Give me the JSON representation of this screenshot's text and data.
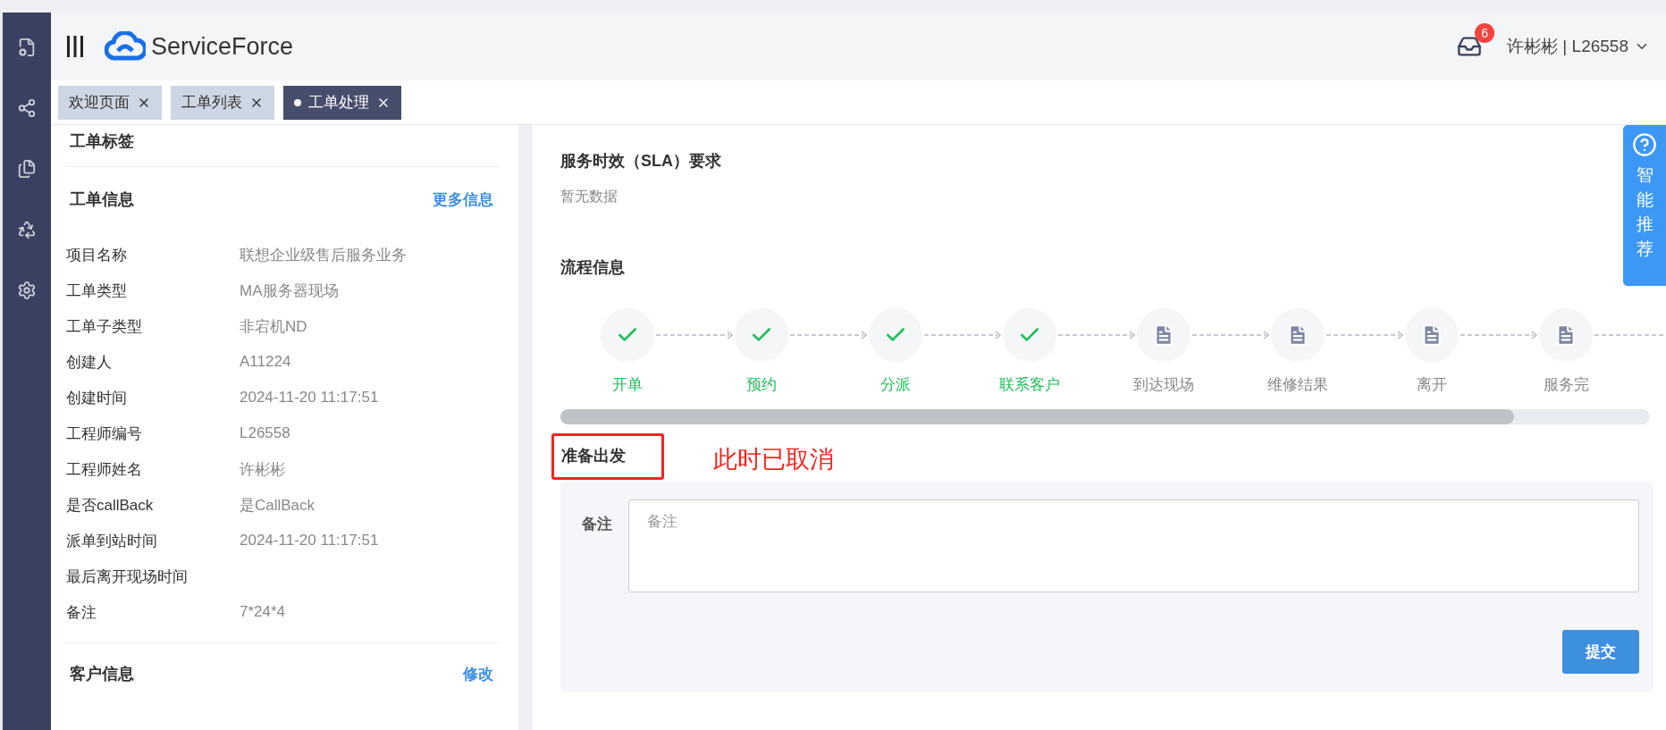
{
  "header": {
    "logo": "ServiceForce",
    "notification_count": "6",
    "user": "许彬彬 | L26558"
  },
  "tabs": [
    {
      "label": "欢迎页面",
      "selected": false
    },
    {
      "label": "工单列表",
      "selected": false
    },
    {
      "label": "工单处理",
      "selected": true
    }
  ],
  "left": {
    "tags_title": "工单标签",
    "info": {
      "title": "工单信息",
      "link": "更多信息",
      "rows": [
        {
          "label": "项目名称",
          "value": "联想企业级售后服务业务"
        },
        {
          "label": "工单类型",
          "value": "MA服务器现场"
        },
        {
          "label": "工单子类型",
          "value": "非宕机ND"
        },
        {
          "label": "创建人",
          "value": "A11224"
        },
        {
          "label": "创建时间",
          "value": "2024-11-20 11:17:51"
        },
        {
          "label": "工程师编号",
          "value": "L26558"
        },
        {
          "label": "工程师姓名",
          "value": "许彬彬"
        },
        {
          "label": "是否callBack",
          "value": "是CallBack"
        },
        {
          "label": "派单到站时间",
          "value": "2024-11-20 11:17:51"
        },
        {
          "label": "最后离开现场时间"
        },
        {
          "label": "备注",
          "value": "7*24*4"
        }
      ]
    },
    "customer": {
      "title": "客户信息",
      "link": "修改"
    }
  },
  "right": {
    "sla": {
      "title": "服务时效（SLA）要求",
      "empty": "暂无数据"
    },
    "flow": {
      "title": "流程信息",
      "steps": [
        {
          "label": "开单",
          "done": true
        },
        {
          "label": "预约",
          "done": true
        },
        {
          "label": "分派",
          "done": true
        },
        {
          "label": "联系客户",
          "done": true
        },
        {
          "label": "到达现场",
          "done": false
        },
        {
          "label": "维修结果",
          "done": false
        },
        {
          "label": "离开",
          "done": false
        },
        {
          "label": "服务完",
          "done": false
        }
      ]
    },
    "form": {
      "title": "准备出发",
      "annotation": "此时已取消",
      "field_label": "备注",
      "placeholder": "备注",
      "submit": "提交"
    }
  },
  "side_tab": {
    "label": "智能推荐"
  }
}
